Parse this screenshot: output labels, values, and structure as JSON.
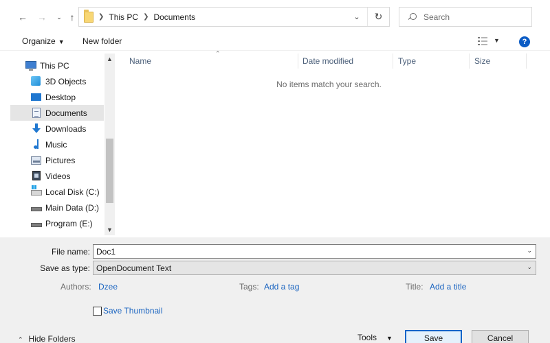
{
  "address": {
    "crumbs": [
      "This PC",
      "Documents"
    ],
    "search_placeholder": "Search"
  },
  "commands": {
    "organize": "Organize",
    "new_folder": "New folder"
  },
  "nav": {
    "items": [
      {
        "label": "This PC",
        "icon": "computer-icon"
      },
      {
        "label": "3D Objects",
        "icon": "3d-objects-icon"
      },
      {
        "label": "Desktop",
        "icon": "desktop-icon"
      },
      {
        "label": "Documents",
        "icon": "documents-icon",
        "selected": true
      },
      {
        "label": "Downloads",
        "icon": "downloads-icon"
      },
      {
        "label": "Music",
        "icon": "music-icon"
      },
      {
        "label": "Pictures",
        "icon": "pictures-icon"
      },
      {
        "label": "Videos",
        "icon": "videos-icon"
      },
      {
        "label": "Local Disk (C:)",
        "icon": "local-disk-icon"
      },
      {
        "label": "Main Data (D:)",
        "icon": "drive-icon"
      },
      {
        "label": "Program (E:)",
        "icon": "drive-icon"
      }
    ]
  },
  "filelist": {
    "columns": [
      "Name",
      "Date modified",
      "Type",
      "Size"
    ],
    "empty_message": "No items match your search."
  },
  "save": {
    "file_name_label": "File name:",
    "file_name_value": "Doc1",
    "save_type_label": "Save as type:",
    "save_type_value": "OpenDocument Text",
    "authors_label": "Authors:",
    "authors_value": "Dzee",
    "tags_label": "Tags:",
    "tags_value": "Add a tag",
    "title_label": "Title:",
    "title_value": "Add a title",
    "thumbnail_label": "Save Thumbnail",
    "thumbnail_checked": false
  },
  "footer": {
    "hide_folders": "Hide Folders",
    "tools": "Tools",
    "save": "Save",
    "cancel": "Cancel"
  },
  "colors": {
    "accent": "#0a64c8",
    "link": "#1a64c0",
    "selected_bg": "#e5e5e5",
    "panel_bg": "#f0f0f0"
  }
}
